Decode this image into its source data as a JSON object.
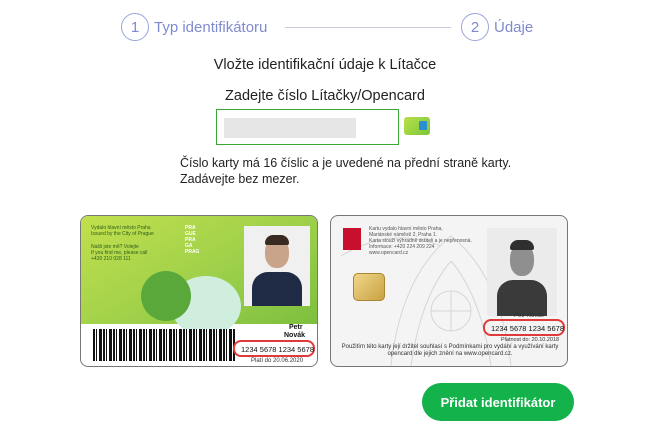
{
  "stepper": {
    "step1": {
      "number": "1",
      "label": "Typ identifikátoru"
    },
    "step2": {
      "number": "2",
      "label": "Údaje"
    }
  },
  "title": "Vložte identifikační údaje k Lítačce",
  "field_label": "Zadejte číslo Lítačky/Opencard",
  "input": {
    "value": "",
    "placeholder": ""
  },
  "hint_line1": "Číslo karty má 16 číslic a je uvedené na přední straně karty.",
  "hint_line2": "Zadávejte bez mezer.",
  "card_litacka": {
    "issuer_cz": "Vydalo hlavní město Praha",
    "issuer_en": "Issued by the City of Prague",
    "found_cz": "Našli jste mě? Volejte",
    "found_en": "If you find me, please call",
    "phone": "+420 210 028 111",
    "brand": [
      "PRA",
      "GUE",
      "PRA",
      "GA",
      "PRAG"
    ],
    "name_first": "Petr",
    "name_last": "Novák",
    "number": "1234 5678 1234 5678",
    "valid": "Platí do 20.06.2020"
  },
  "card_opencard": {
    "text": [
      "Kartu vydalo hlavní město Praha,",
      "Mariánské náměstí 2, Praha 1.",
      "Karta slouží výhradně držiteli a je nepřenosná.",
      "Informace: +420 224 209 224",
      "www.opencard.cz"
    ],
    "name": "Petr Novák",
    "number": "1234 5678 1234 5678",
    "valid": "Platnost do: 20.10.2018",
    "footer": "Použitím této karty její držitel souhlasí s Podmínkami pro vydání a využívání karty opencard dle jejich znění na www.opencard.cz."
  },
  "submit_label": "Přidat identifikátor",
  "colors": {
    "accent": "#7f8bcf",
    "button": "#13b24b",
    "highlight": "#e03a3a",
    "input_border": "#3aa63a"
  }
}
